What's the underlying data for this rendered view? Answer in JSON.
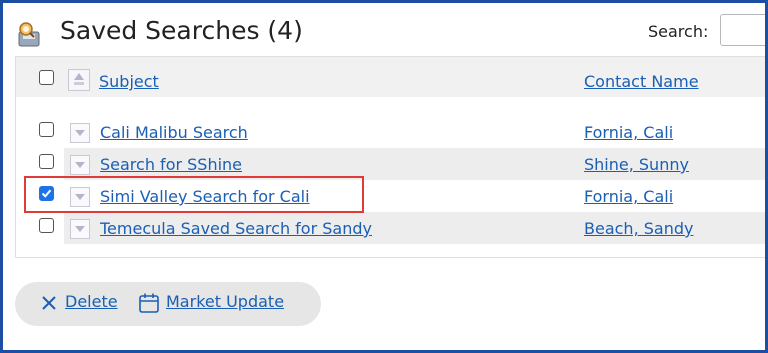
{
  "header": {
    "title": "Saved Searches (4)",
    "search_label": "Search:",
    "search_value": ""
  },
  "table": {
    "columns": [
      "Subject",
      "Contact Name"
    ],
    "rows": [
      {
        "subject": "Cali Malibu Search",
        "contact": "Fornia, Cali",
        "checked": false
      },
      {
        "subject": "Search for SShine",
        "contact": "Shine, Sunny",
        "checked": false
      },
      {
        "subject": "Simi Valley Search for Cali",
        "contact": "Fornia, Cali",
        "checked": true
      },
      {
        "subject": "Temecula Saved Search for Sandy",
        "contact": "Beach, Sandy",
        "checked": false
      }
    ]
  },
  "actions": {
    "delete_label": "Delete",
    "market_update_label": "Market Update"
  },
  "colors": {
    "frame": "#1c4ea3",
    "link": "#1a5fb4",
    "checkbox_checked": "#1a73e8",
    "highlight": "#e03a3a"
  },
  "icons": {
    "app": "saved-search-icon",
    "delete": "close-icon",
    "market_update": "calendar-icon"
  }
}
